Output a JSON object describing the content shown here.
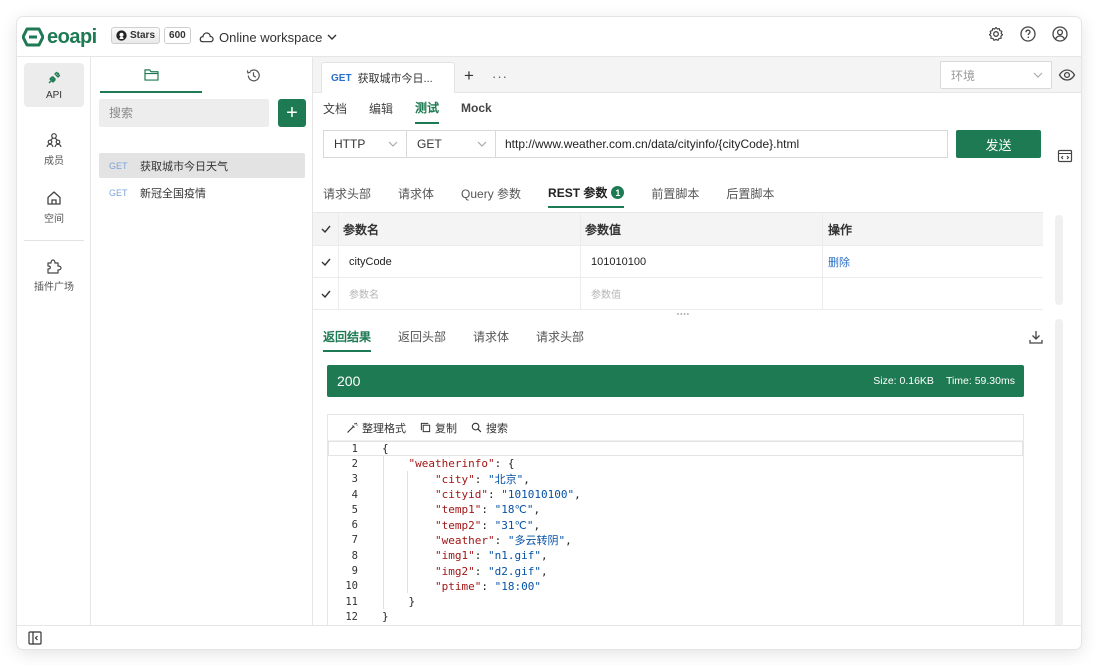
{
  "app": {
    "logo_text": "eoapi",
    "github": {
      "stars_label": "Stars",
      "stars_count": "600"
    },
    "workspace": "Online workspace",
    "header_icons": [
      "settings-icon",
      "help-icon",
      "user-icon"
    ]
  },
  "rail": {
    "items": [
      {
        "label": "API",
        "icon": "api-icon",
        "active": true
      },
      {
        "label": "成员",
        "icon": "members-icon"
      },
      {
        "label": "空间",
        "icon": "home-icon"
      },
      {
        "label": "插件广场",
        "icon": "puzzle-icon"
      }
    ]
  },
  "sidebar": {
    "search_placeholder": "搜索",
    "add_label": "+",
    "apis": [
      {
        "method": "GET",
        "name": "获取城市今日天气",
        "active": true
      },
      {
        "method": "GET",
        "name": "新冠全国疫情"
      }
    ]
  },
  "tabs": {
    "active_tab": {
      "method": "GET",
      "title": "获取城市今日..."
    },
    "plus": "+",
    "more": "···",
    "env_placeholder": "环境"
  },
  "modes": [
    "文档",
    "编辑",
    "测试",
    "Mock"
  ],
  "active_mode": "测试",
  "request": {
    "protocol": "HTTP",
    "method": "GET",
    "url": "http://www.weather.com.cn/data/cityinfo/{cityCode}.html",
    "send_label": "发送"
  },
  "request_tabs": {
    "items": [
      "请求头部",
      "请求体",
      "Query 参数",
      "REST 参数",
      "前置脚本",
      "后置脚本"
    ],
    "active": "REST 参数",
    "rest_badge": "1"
  },
  "params_table": {
    "headers": {
      "name": "参数名",
      "value": "参数值",
      "action": "操作"
    },
    "rows": [
      {
        "name": "cityCode",
        "value": "101010100",
        "action": "删除"
      }
    ],
    "empty_row": {
      "name_placeholder": "参数名",
      "value_placeholder": "参数值"
    }
  },
  "response_tabs": {
    "items": [
      "返回结果",
      "返回头部",
      "请求体",
      "请求头部"
    ],
    "active": "返回结果"
  },
  "response": {
    "status_code": "200",
    "size": "Size: 0.16KB",
    "time": "Time: 59.30ms",
    "toolbar": {
      "format": "整理格式",
      "copy": "复制",
      "search": "搜索"
    },
    "lines": [
      {
        "n": "1",
        "indent": "",
        "segs": [
          [
            "p",
            "{"
          ]
        ]
      },
      {
        "n": "2",
        "indent": "    ",
        "segs": [
          [
            "k",
            "\"weatherinfo\""
          ],
          [
            "p",
            ": {"
          ]
        ]
      },
      {
        "n": "3",
        "indent": "        ",
        "segs": [
          [
            "k",
            "\"city\""
          ],
          [
            "p",
            ": "
          ],
          [
            "s",
            "\"北京\""
          ],
          [
            "p",
            ","
          ]
        ]
      },
      {
        "n": "4",
        "indent": "        ",
        "segs": [
          [
            "k",
            "\"cityid\""
          ],
          [
            "p",
            ": "
          ],
          [
            "s",
            "\"101010100\""
          ],
          [
            "p",
            ","
          ]
        ]
      },
      {
        "n": "5",
        "indent": "        ",
        "segs": [
          [
            "k",
            "\"temp1\""
          ],
          [
            "p",
            ": "
          ],
          [
            "s",
            "\"18℃\""
          ],
          [
            "p",
            ","
          ]
        ]
      },
      {
        "n": "6",
        "indent": "        ",
        "segs": [
          [
            "k",
            "\"temp2\""
          ],
          [
            "p",
            ": "
          ],
          [
            "s",
            "\"31℃\""
          ],
          [
            "p",
            ","
          ]
        ]
      },
      {
        "n": "7",
        "indent": "        ",
        "segs": [
          [
            "k",
            "\"weather\""
          ],
          [
            "p",
            ": "
          ],
          [
            "s",
            "\"多云转阴\""
          ],
          [
            "p",
            ","
          ]
        ]
      },
      {
        "n": "8",
        "indent": "        ",
        "segs": [
          [
            "k",
            "\"img1\""
          ],
          [
            "p",
            ": "
          ],
          [
            "s",
            "\"n1.gif\""
          ],
          [
            "p",
            ","
          ]
        ]
      },
      {
        "n": "9",
        "indent": "        ",
        "segs": [
          [
            "k",
            "\"img2\""
          ],
          [
            "p",
            ": "
          ],
          [
            "s",
            "\"d2.gif\""
          ],
          [
            "p",
            ","
          ]
        ]
      },
      {
        "n": "10",
        "indent": "        ",
        "segs": [
          [
            "k",
            "\"ptime\""
          ],
          [
            "p",
            ": "
          ],
          [
            "s",
            "\"18:00\""
          ]
        ]
      },
      {
        "n": "11",
        "indent": "    ",
        "segs": [
          [
            "p",
            "}"
          ]
        ]
      },
      {
        "n": "12",
        "indent": "",
        "segs": [
          [
            "p",
            "}"
          ]
        ]
      }
    ]
  },
  "colors": {
    "accent": "#1e7a52",
    "method_blue": "#2a6fc9"
  }
}
